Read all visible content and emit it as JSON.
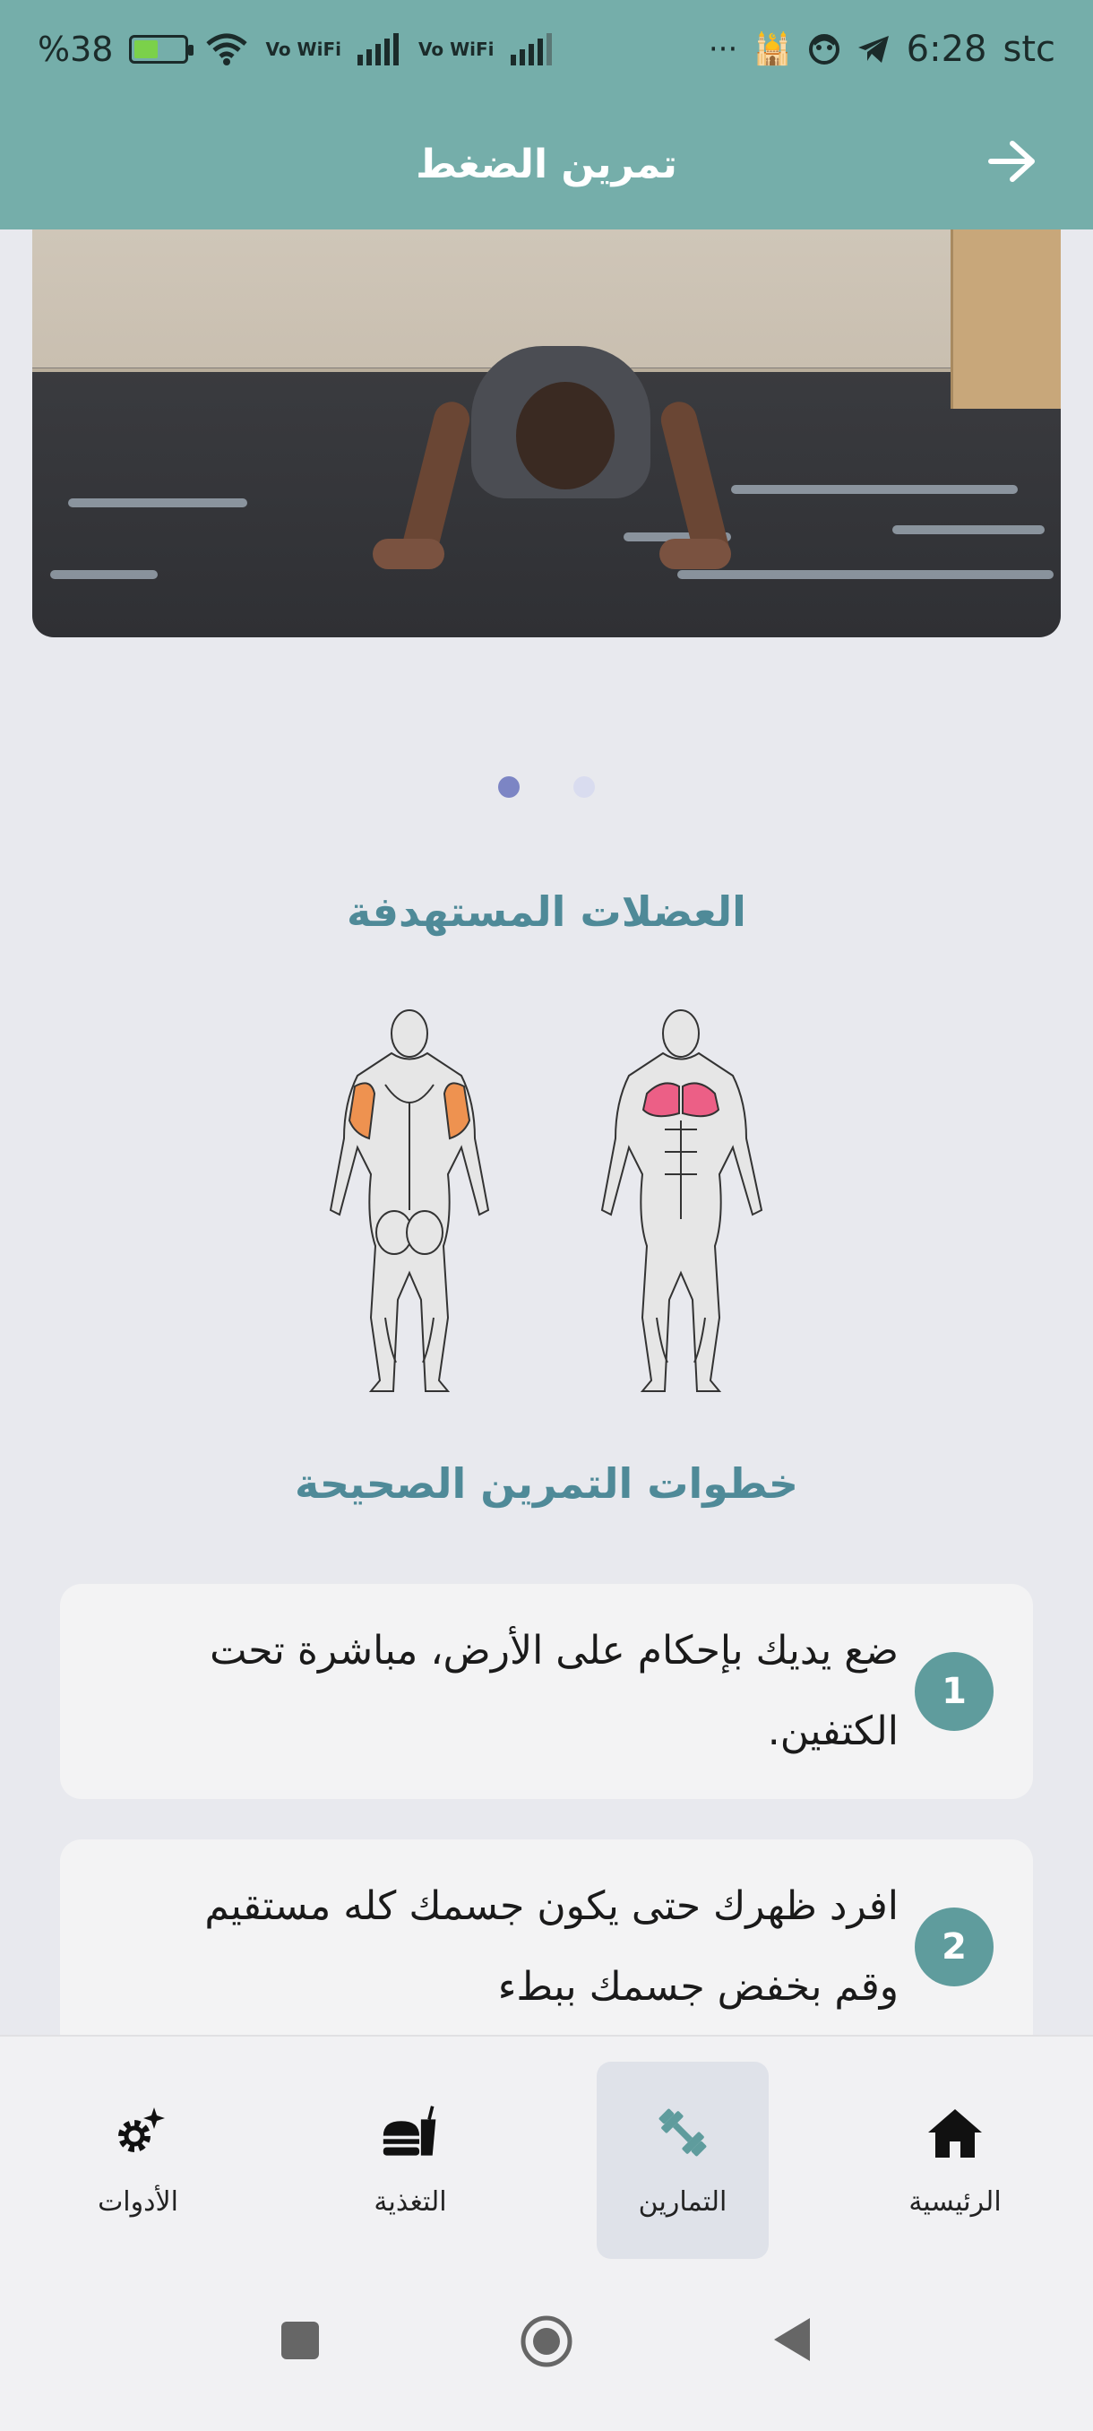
{
  "status_bar": {
    "battery_percent": "%38",
    "vowifi_1": "Vo WiFi",
    "vowifi_2": "Vo WiFi",
    "dots": "···",
    "time": "6:28",
    "carrier": "stc"
  },
  "header": {
    "title": "تمرين الضغط",
    "back_icon": "arrow-right-icon"
  },
  "carousel": {
    "page_count": 2,
    "active_page": 1
  },
  "muscles": {
    "title": "العضلات المستهدفة",
    "highlight_colors": {
      "chest": "#ec5f86",
      "triceps": "#ee9250"
    }
  },
  "steps": {
    "title": "خطوات التمرين الصحيحة",
    "items": [
      {
        "number": "1",
        "line1": "ضع يديك بإحكام على الأرض، مباشرة تحت",
        "line2": "الكتفين."
      },
      {
        "number": "2",
        "line1": "افرد ظهرك حتى يكون جسمك كله مستقيم",
        "line2": "وقم بخفض جسمك ببطء"
      }
    ]
  },
  "bottom_nav": {
    "items": [
      {
        "label": "الرئيسية",
        "icon": "home-icon"
      },
      {
        "label": "التمارين",
        "icon": "dumbbell-icon",
        "active": true
      },
      {
        "label": "التغذية",
        "icon": "food-icon"
      },
      {
        "label": "الأدوات",
        "icon": "tools-gear-icon"
      }
    ]
  },
  "colors": {
    "header": "#75aeaa",
    "accent_title": "#4f8a98",
    "step_number_bg": "#5f9c9d",
    "active_dot": "#7c85c4"
  }
}
